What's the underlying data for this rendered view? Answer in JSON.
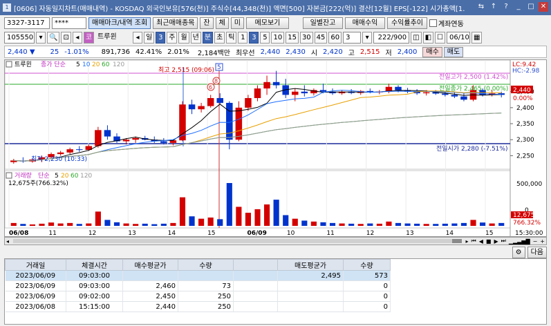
{
  "window": {
    "number": "1",
    "title": "[0606] 자동일지차트(매매내역) - KOSDAQ 외국인보유[576(천)] 주식수[44,348(천)] 액면[500] 자본금[222(억)] 결산[12월] EPS[-122] 시가총액[1."
  },
  "toolbar1": {
    "code": "3327-3117",
    "password": "****",
    "buttons": [
      "매매마크/내역 조회",
      "최근매매종목",
      "잔",
      "체",
      "미",
      "메모보기"
    ],
    "right_buttons": [
      "일별잔고",
      "매매수익",
      "수익률추이"
    ],
    "checkbox_label": "계좌연동"
  },
  "toolbar2": {
    "stock_code": "105550",
    "stock_name": "트루윈",
    "period_sel": "일",
    "num_sel": "3",
    "periods": [
      "주",
      "월",
      "년",
      "분",
      "초",
      "틱"
    ],
    "numbers": [
      "1",
      "3",
      "5",
      "10",
      "15",
      "30",
      "45",
      "60"
    ],
    "num2": "3",
    "count": "222/900",
    "date": "06/10"
  },
  "quote": {
    "price": "2,440",
    "change": "25",
    "rate": "-1.01%",
    "volume": "891,736",
    "vol_rate": "42.41%",
    "turnover": "2.01%",
    "amount": "2,184백만",
    "best_label": "최우선",
    "ask": "2,440",
    "bid": "2,430",
    "open_label": "시",
    "open": "2,420",
    "high_label": "고",
    "high": "2,515",
    "low_label": "저",
    "low": "2,400",
    "buy_btn": "매수",
    "sell_btn": "매도"
  },
  "chart": {
    "stock_label": "트루윈",
    "ma_label": "종가 단순",
    "ma_periods": [
      "5",
      "10",
      "20",
      "60",
      "120"
    ],
    "ma_colors": [
      "#000000",
      "#1e6fff",
      "#e8a000",
      "#2aa82a",
      "#999999"
    ],
    "high_annot": "최고 2,515 (09:06)",
    "low_annot": "최저 2,230 (10:33)",
    "prev_high_annot": "전일고가 2,500 (1.42%)",
    "prev_close_annot": "전일종가 2,465 (0.00%)",
    "prev_open_annot": "전일시가 2,280 (-7.51%)",
    "lc": "LC:9.42",
    "hc": "HC:-2.98",
    "price_box": "2,440",
    "price_pct": "0.00%",
    "y_ticks": [
      "2,450",
      "2,400",
      "2,350",
      "2,300",
      "2,250"
    ],
    "vol_label": "거래량",
    "vol_ma_label": "단순",
    "vol_ma_periods": [
      "5",
      "20",
      "60",
      "120"
    ],
    "vol_value": "12,675주(766.32%)",
    "vol_ticks": [
      "500,000",
      "0"
    ],
    "vol_box": "12,675",
    "vol_pct": "766.32%",
    "x_labels": [
      "06/08",
      "11",
      "12",
      "13",
      "14",
      "15",
      "06/09",
      "10",
      "11",
      "12",
      "13",
      "14",
      "15"
    ],
    "time_label": "15:30:00",
    "marker_nums": [
      "5",
      "6",
      "8"
    ]
  },
  "chart_data": {
    "type": "candlestick",
    "y_range": [
      2225,
      2540
    ],
    "candles": [
      {
        "o": 2230,
        "h": 2240,
        "l": 2225,
        "c": 2235
      },
      {
        "o": 2235,
        "h": 2245,
        "l": 2228,
        "c": 2232
      },
      {
        "o": 2232,
        "h": 2240,
        "l": 2228,
        "c": 2238
      },
      {
        "o": 2238,
        "h": 2250,
        "l": 2230,
        "c": 2245
      },
      {
        "o": 2245,
        "h": 2260,
        "l": 2240,
        "c": 2255
      },
      {
        "o": 2255,
        "h": 2265,
        "l": 2250,
        "c": 2260
      },
      {
        "o": 2260,
        "h": 2275,
        "l": 2255,
        "c": 2270
      },
      {
        "o": 2270,
        "h": 2280,
        "l": 2262,
        "c": 2268
      },
      {
        "o": 2268,
        "h": 2285,
        "l": 2265,
        "c": 2280
      },
      {
        "o": 2280,
        "h": 2340,
        "l": 2275,
        "c": 2330
      },
      {
        "o": 2330,
        "h": 2345,
        "l": 2300,
        "c": 2310
      },
      {
        "o": 2310,
        "h": 2320,
        "l": 2290,
        "c": 2295
      },
      {
        "o": 2295,
        "h": 2305,
        "l": 2285,
        "c": 2300
      },
      {
        "o": 2300,
        "h": 2310,
        "l": 2290,
        "c": 2305
      },
      {
        "o": 2305,
        "h": 2312,
        "l": 2298,
        "c": 2300
      },
      {
        "o": 2300,
        "h": 2310,
        "l": 2290,
        "c": 2295
      },
      {
        "o": 2295,
        "h": 2305,
        "l": 2285,
        "c": 2290
      },
      {
        "o": 2290,
        "h": 2300,
        "l": 2282,
        "c": 2298
      },
      {
        "o": 2298,
        "h": 2420,
        "l": 2295,
        "c": 2410
      },
      {
        "o": 2410,
        "h": 2425,
        "l": 2380,
        "c": 2395
      },
      {
        "o": 2395,
        "h": 2415,
        "l": 2385,
        "c": 2405
      },
      {
        "o": 2405,
        "h": 2440,
        "l": 2400,
        "c": 2430
      },
      {
        "o": 2430,
        "h": 2445,
        "l": 2410,
        "c": 2415
      },
      {
        "o": 2415,
        "h": 2420,
        "l": 2270,
        "c": 2300
      },
      {
        "o": 2300,
        "h": 2420,
        "l": 2295,
        "c": 2400
      },
      {
        "o": 2400,
        "h": 2440,
        "l": 2390,
        "c": 2430
      },
      {
        "o": 2430,
        "h": 2470,
        "l": 2420,
        "c": 2460
      },
      {
        "o": 2460,
        "h": 2500,
        "l": 2440,
        "c": 2480
      },
      {
        "o": 2480,
        "h": 2515,
        "l": 2460,
        "c": 2470
      },
      {
        "o": 2470,
        "h": 2490,
        "l": 2430,
        "c": 2440
      },
      {
        "o": 2440,
        "h": 2460,
        "l": 2420,
        "c": 2450
      },
      {
        "o": 2450,
        "h": 2470,
        "l": 2435,
        "c": 2445
      },
      {
        "o": 2445,
        "h": 2460,
        "l": 2438,
        "c": 2455
      },
      {
        "o": 2455,
        "h": 2475,
        "l": 2445,
        "c": 2450
      },
      {
        "o": 2450,
        "h": 2460,
        "l": 2440,
        "c": 2445
      },
      {
        "o": 2445,
        "h": 2455,
        "l": 2440,
        "c": 2450
      },
      {
        "o": 2450,
        "h": 2458,
        "l": 2442,
        "c": 2446
      },
      {
        "o": 2446,
        "h": 2455,
        "l": 2440,
        "c": 2452
      },
      {
        "o": 2452,
        "h": 2460,
        "l": 2445,
        "c": 2448
      },
      {
        "o": 2448,
        "h": 2455,
        "l": 2442,
        "c": 2450
      },
      {
        "o": 2450,
        "h": 2475,
        "l": 2445,
        "c": 2465
      },
      {
        "o": 2465,
        "h": 2470,
        "l": 2448,
        "c": 2455
      },
      {
        "o": 2455,
        "h": 2462,
        "l": 2445,
        "c": 2450
      },
      {
        "o": 2450,
        "h": 2458,
        "l": 2440,
        "c": 2445
      },
      {
        "o": 2445,
        "h": 2455,
        "l": 2438,
        "c": 2448
      },
      {
        "o": 2448,
        "h": 2455,
        "l": 2440,
        "c": 2444
      },
      {
        "o": 2444,
        "h": 2450,
        "l": 2435,
        "c": 2440
      },
      {
        "o": 2440,
        "h": 2448,
        "l": 2430,
        "c": 2435
      },
      {
        "o": 2435,
        "h": 2445,
        "l": 2420,
        "c": 2425
      },
      {
        "o": 2425,
        "h": 2470,
        "l": 2420,
        "c": 2455
      },
      {
        "o": 2455,
        "h": 2460,
        "l": 2435,
        "c": 2440
      },
      {
        "o": 2440,
        "h": 2455,
        "l": 2435,
        "c": 2445
      },
      {
        "o": 2445,
        "h": 2450,
        "l": 2432,
        "c": 2440
      }
    ],
    "volumes": [
      12,
      8,
      6,
      9,
      14,
      10,
      12,
      8,
      10,
      60,
      25,
      15,
      10,
      8,
      9,
      7,
      9,
      12,
      120,
      40,
      30,
      35,
      28,
      180,
      80,
      55,
      70,
      90,
      110,
      45,
      30,
      22,
      18,
      15,
      12,
      10,
      9,
      8,
      10,
      9,
      18,
      12,
      10,
      9,
      8,
      8,
      9,
      10,
      12,
      25,
      14,
      10,
      12
    ]
  },
  "table": {
    "headers": [
      "거래일",
      "체결시간",
      "매수평균가",
      "수량",
      "",
      "매도평균가",
      "수량"
    ],
    "rows": [
      {
        "date": "2023/06/09",
        "time": "09:03:00",
        "buy_price": "",
        "buy_qty": "",
        "sell_price": "2,495",
        "sell_qty": "573"
      },
      {
        "date": "2023/06/09",
        "time": "09:03:00",
        "buy_price": "2,460",
        "buy_qty": "73",
        "sell_price": "",
        "sell_qty": "0"
      },
      {
        "date": "2023/06/09",
        "time": "09:02:00",
        "buy_price": "2,450",
        "buy_qty": "250",
        "sell_price": "",
        "sell_qty": "0"
      },
      {
        "date": "2023/06/08",
        "time": "15:15:00",
        "buy_price": "2,440",
        "buy_qty": "250",
        "sell_price": "",
        "sell_qty": "0"
      }
    ],
    "next_btn": "다음"
  }
}
